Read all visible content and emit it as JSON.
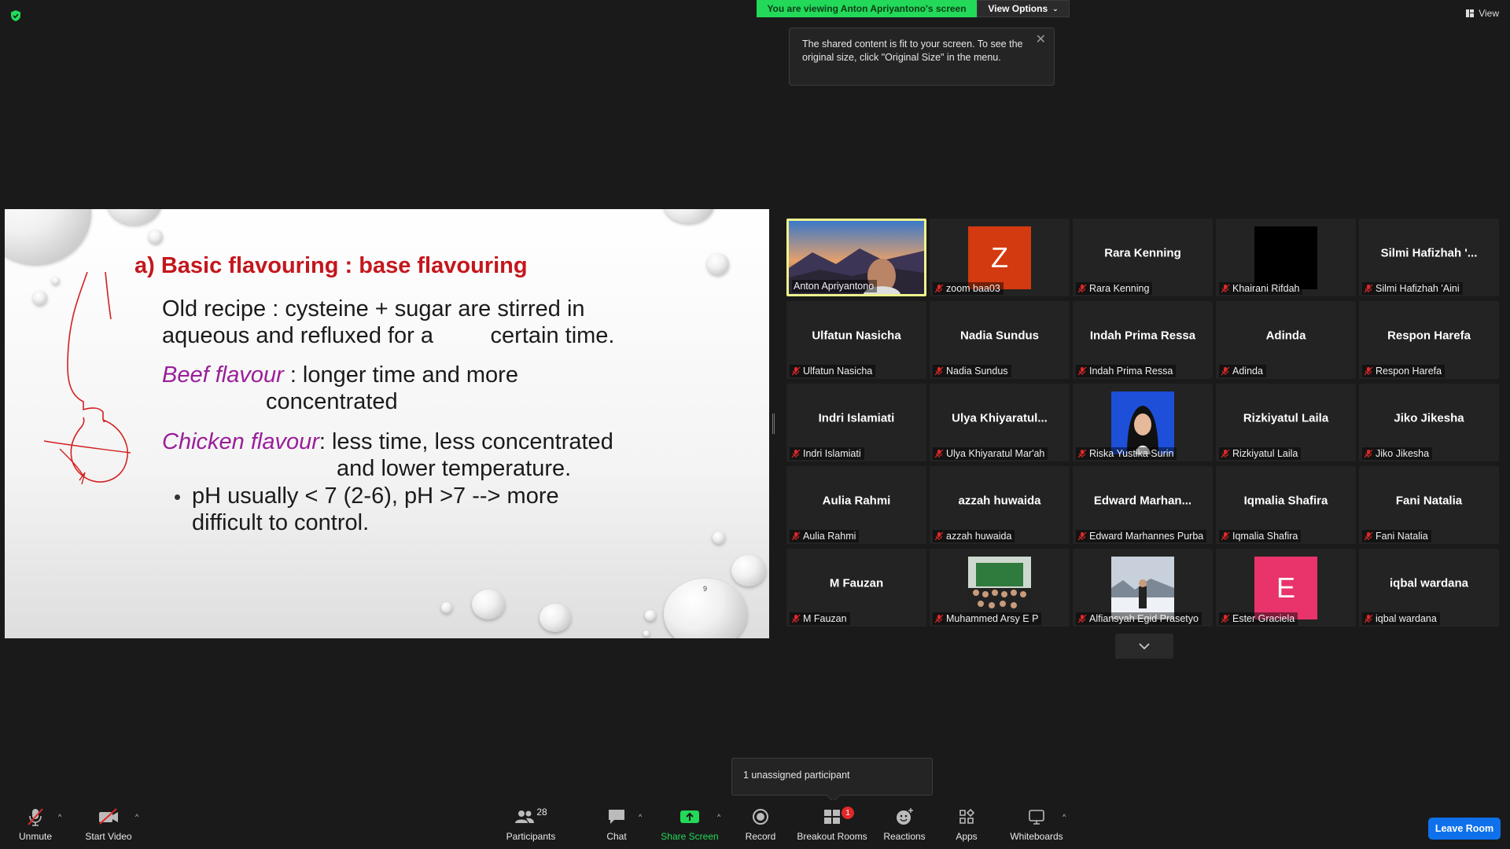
{
  "banner": {
    "viewing_text": "You are viewing Anton Apriyantono's screen",
    "view_options_label": "View Options",
    "view_label": "View"
  },
  "tooltip": {
    "message": "The shared content is fit to your screen. To see the original size, click \"Original Size\" in the menu."
  },
  "slide": {
    "title": "a) Basic flavouring  :  base flavouring",
    "line1": "Old recipe : cysteine + sugar are stirred in",
    "line2": "aqueous and refluxed for a         certain time.",
    "beef_keyword": "Beef flavour",
    "beef_rest": " : longer time and more",
    "beef_line2": "concentrated",
    "chicken_keyword": "Chicken flavour",
    "chicken_rest": ": less time, less concentrated",
    "chicken_line2": "and lower temperature.",
    "bullet_line1": "pH usually < 7 (2-6), pH >7 --> more",
    "bullet_line2": "difficult to control.",
    "page_number": "9"
  },
  "participants": [
    {
      "name": "Anton Apriyantono",
      "display": "",
      "type": "photo-mountain",
      "active": true,
      "muted": false
    },
    {
      "name": "zoom baa03",
      "display": "Z",
      "type": "letter",
      "color": "#d43a0f",
      "muted": true
    },
    {
      "name": "Rara Kenning",
      "display": "Rara Kenning",
      "type": "name",
      "muted": true
    },
    {
      "name": "Khairani Rifdah",
      "display": "",
      "type": "black",
      "muted": true
    },
    {
      "name": "Silmi Hafizhah 'Aini",
      "display": "Silmi  Hafizhah  '...",
      "type": "name",
      "muted": true
    },
    {
      "name": "Ulfatun Nasicha",
      "display": "Ulfatun Nasicha",
      "type": "name",
      "muted": true
    },
    {
      "name": "Nadia Sundus",
      "display": "Nadia Sundus",
      "type": "name",
      "muted": true
    },
    {
      "name": "Indah Prima Ressa",
      "display": "Indah Prima Ressa",
      "type": "name",
      "muted": true
    },
    {
      "name": "Adinda",
      "display": "Adinda",
      "type": "name",
      "muted": true
    },
    {
      "name": "Respon Harefa",
      "display": "Respon Harefa",
      "type": "name",
      "muted": true
    },
    {
      "name": "Indri Islamiati",
      "display": "Indri Islamiati",
      "type": "name",
      "muted": true
    },
    {
      "name": "Ulya Khiyaratul Mar'ah",
      "display": "Ulya  Khiyaratul...",
      "type": "name",
      "muted": true
    },
    {
      "name": "Riska Yustika Surin",
      "display": "",
      "type": "photo-hijab",
      "muted": true
    },
    {
      "name": "Rizkiyatul Laila",
      "display": "Rizkiyatul Laila",
      "type": "name",
      "muted": true
    },
    {
      "name": "Jiko Jikesha",
      "display": "Jiko Jikesha",
      "type": "name",
      "muted": true
    },
    {
      "name": "Aulia Rahmi",
      "display": "Aulia Rahmi",
      "type": "name",
      "muted": true
    },
    {
      "name": "azzah huwaida",
      "display": "azzah huwaida",
      "type": "name",
      "muted": true
    },
    {
      "name": "Edward Marhannes Purba",
      "display": "Edward  Marhan...",
      "type": "name",
      "muted": true
    },
    {
      "name": "Iqmalia Shafira",
      "display": "Iqmalia Shafira",
      "type": "name",
      "muted": true
    },
    {
      "name": "Fani Natalia",
      "display": "Fani Natalia",
      "type": "name",
      "muted": true
    },
    {
      "name": "M Fauzan",
      "display": "M Fauzan",
      "type": "name",
      "muted": true
    },
    {
      "name": "Muhammed Arsy E P",
      "display": "",
      "type": "photo-group",
      "muted": true
    },
    {
      "name": "Alfiansyah Egid Prasetyo",
      "display": "",
      "type": "photo-snow",
      "muted": true
    },
    {
      "name": "Ester Graciela",
      "display": "E",
      "type": "letter",
      "color": "#e8346a",
      "muted": true
    },
    {
      "name": "iqbal wardana",
      "display": "iqbal wardana",
      "type": "name",
      "muted": true
    }
  ],
  "breakout_tip": "1 unassigned participant",
  "toolbar": {
    "unmute": "Unmute",
    "start_video": "Start Video",
    "participants": "Participants",
    "participants_count": "28",
    "chat": "Chat",
    "share_screen": "Share Screen",
    "record": "Record",
    "breakout_rooms": "Breakout Rooms",
    "breakout_badge": "1",
    "reactions": "Reactions",
    "apps": "Apps",
    "whiteboards": "Whiteboards",
    "leave_room": "Leave Room"
  },
  "colors": {
    "accent_green": "#23d959",
    "leave_blue": "#0e71eb",
    "slide_title_red": "#c4171d",
    "slide_keyword_purple": "#9a1e99",
    "active_speaker_border": "#eef38d"
  }
}
